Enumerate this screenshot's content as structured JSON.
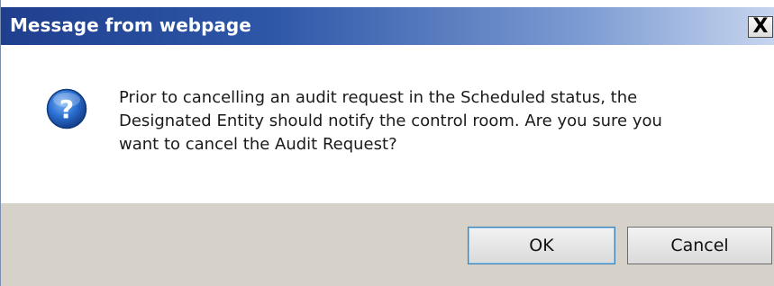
{
  "window": {
    "title": "Message from webpage",
    "close_glyph": "X"
  },
  "dialog": {
    "icon": "question-icon",
    "message_lines": [
      "Prior to cancelling an audit request in the Scheduled status, the",
      "Designated Entity should notify the control room. Are you sure you",
      "want to cancel the Audit Request?"
    ]
  },
  "buttons": {
    "ok_label": "OK",
    "cancel_label": "Cancel"
  },
  "colors": {
    "titlebar_start": "#1f3f8e",
    "titlebar_end": "#c7d5ee",
    "footer_bg": "#d6d2ca",
    "icon_blue": "#2a6fd1"
  }
}
